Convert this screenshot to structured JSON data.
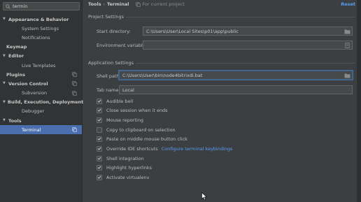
{
  "sidebar": {
    "search_value": "termin",
    "items": [
      {
        "label": "Appearance & Behavior",
        "level": 0,
        "bold": true,
        "expanded": true
      },
      {
        "label": "System Settings",
        "level": 1
      },
      {
        "label": "Notifications",
        "level": 1
      },
      {
        "label": "Keymap",
        "level": 0,
        "bold": true,
        "leaf": true
      },
      {
        "label": "Editor",
        "level": 0,
        "bold": true,
        "expanded": true
      },
      {
        "label": "Live Templates",
        "level": 1
      },
      {
        "label": "Plugins",
        "level": 0,
        "bold": true,
        "leaf": true,
        "project_icon": true
      },
      {
        "label": "Version Control",
        "level": 0,
        "bold": true,
        "expanded": true,
        "project_icon": true
      },
      {
        "label": "Subversion",
        "level": 1,
        "project_icon": true
      },
      {
        "label": "Build, Execution, Deployment",
        "level": 0,
        "bold": true,
        "expanded": true
      },
      {
        "label": "Debugger",
        "level": 1
      },
      {
        "label": "Tools",
        "level": 0,
        "bold": true,
        "expanded": true
      },
      {
        "label": "Terminal",
        "level": 1,
        "selected": true,
        "project_icon": true
      }
    ]
  },
  "header": {
    "crumb_1": "Tools",
    "crumb_sep": "›",
    "crumb_2": "Terminal",
    "scope_label": "For current project",
    "reset_label": "Reset"
  },
  "project_settings": {
    "title": "Project Settings",
    "start_dir_label": "Start directory:",
    "start_dir_value": "C:\\Users\\User\\Local Sites\\p01\\app\\public",
    "env_label": "Environment variables:",
    "env_value": ""
  },
  "app_settings": {
    "title": "Application Settings",
    "shell_label": "Shell path:",
    "shell_value": "C:\\Users\\User\\bin\\node4bitrixdi.bat",
    "tab_label": "Tab name:",
    "tab_value": "Local",
    "checkboxes": [
      {
        "label": "Audible bell",
        "checked": true
      },
      {
        "label": "Close session when it ends",
        "checked": true
      },
      {
        "label": "Mouse reporting",
        "checked": true
      },
      {
        "label": "Copy to clipboard on selection",
        "checked": false
      },
      {
        "label": "Paste on middle mouse button click",
        "checked": true
      },
      {
        "label": "Override IDE shortcuts",
        "checked": true,
        "link": "Configure terminal keybindings"
      },
      {
        "label": "Shell integration",
        "checked": true
      },
      {
        "label": "Highlight hyperlinks",
        "checked": true
      },
      {
        "label": "Activate virtualenv",
        "checked": true
      }
    ]
  },
  "colors": {
    "accent": "#4b6eaf",
    "link": "#589df6",
    "background": "#3c3f41",
    "sidebar": "#313335"
  }
}
